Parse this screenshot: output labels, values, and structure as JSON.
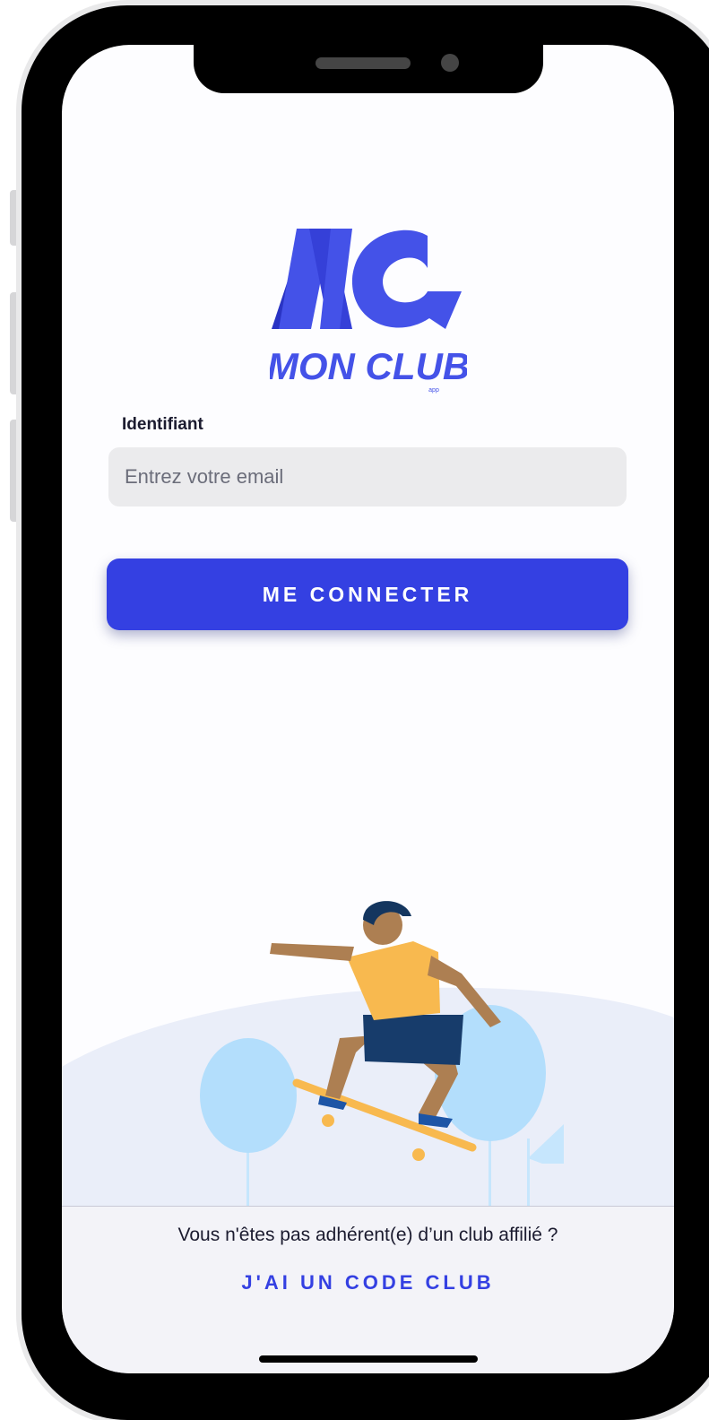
{
  "logo": {
    "brand": "MON CLUB",
    "tag": "app",
    "color": "#4452e8"
  },
  "login": {
    "label": "Identifiant",
    "email_placeholder": "Entrez votre email",
    "email_value": "",
    "submit_label": "ME CONNECTER"
  },
  "footer": {
    "question": "Vous n'êtes pas adhérent(e) d’un club affilié ?",
    "code_link": "J'AI UN CODE CLUB"
  },
  "colors": {
    "accent": "#3440e2",
    "input_bg": "#ebebed",
    "hill": "#eaeef9",
    "tree": "#b3defc"
  },
  "illustration": "skateboarder-illustration"
}
